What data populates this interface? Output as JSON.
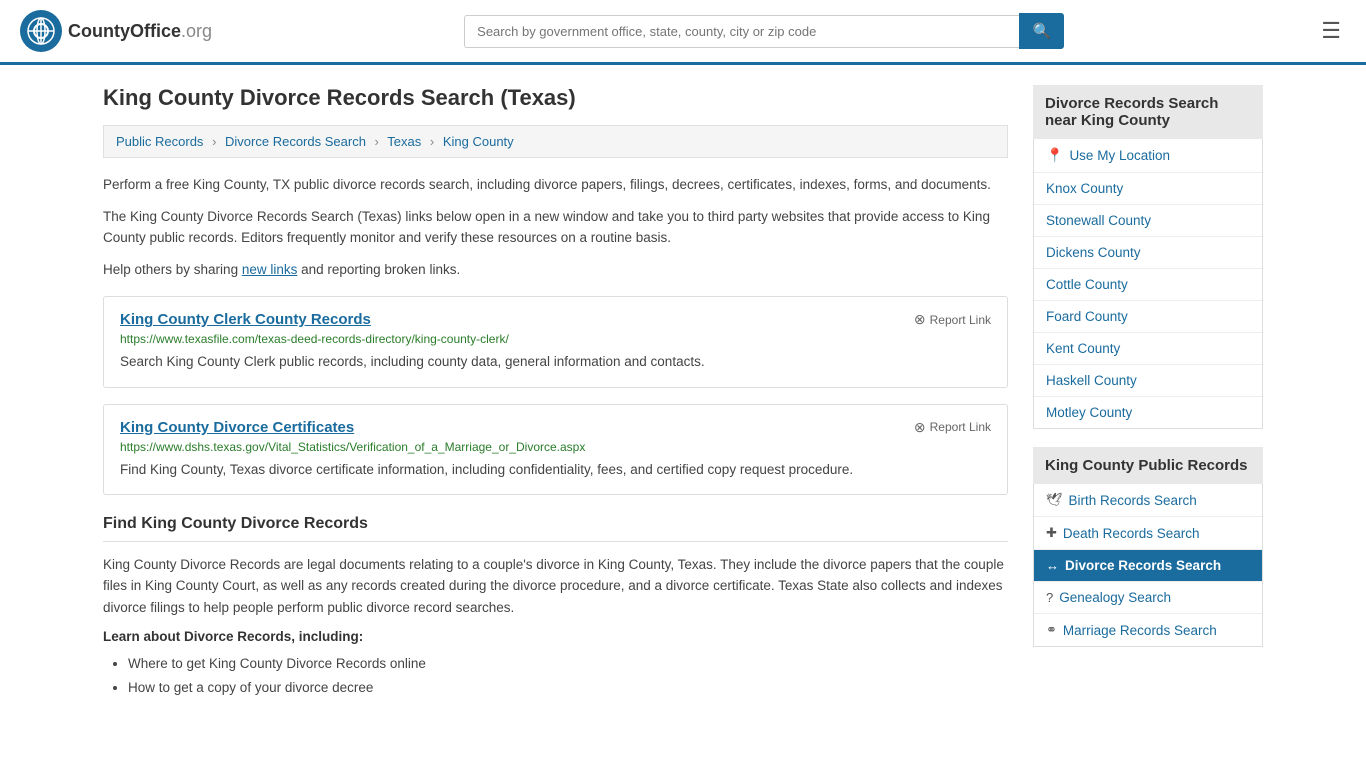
{
  "header": {
    "logo_text": "CountyOffice",
    "logo_org": ".org",
    "search_placeholder": "Search by government office, state, county, city or zip code",
    "search_icon": "🔍",
    "menu_icon": "☰"
  },
  "page": {
    "title": "King County Divorce Records Search (Texas)",
    "breadcrumbs": [
      {
        "label": "Public Records",
        "href": "#"
      },
      {
        "label": "Divorce Records Search",
        "href": "#"
      },
      {
        "label": "Texas",
        "href": "#"
      },
      {
        "label": "King County",
        "href": "#"
      }
    ],
    "intro1": "Perform a free King County, TX public divorce records search, including divorce papers, filings, decrees, certificates, indexes, forms, and documents.",
    "intro2": "The King County Divorce Records Search (Texas) links below open in a new window and take you to third party websites that provide access to King County public records. Editors frequently monitor and verify these resources on a routine basis.",
    "intro3_prefix": "Help others by sharing ",
    "intro3_link": "new links",
    "intro3_suffix": " and reporting broken links.",
    "resources": [
      {
        "title": "King County Clerk County Records",
        "url": "https://www.texasfile.com/texas-deed-records-directory/king-county-clerk/",
        "desc": "Search King County Clerk public records, including county data, general information and contacts.",
        "report_label": "Report Link"
      },
      {
        "title": "King County Divorce Certificates",
        "url": "https://www.dshs.texas.gov/Vital_Statistics/Verification_of_a_Marriage_or_Divorce.aspx",
        "desc": "Find King County, Texas divorce certificate information, including confidentiality, fees, and certified copy request procedure.",
        "report_label": "Report Link"
      }
    ],
    "section_title": "Find King County Divorce Records",
    "body_text": "King County Divorce Records are legal documents relating to a couple's divorce in King County, Texas. They include the divorce papers that the couple files in King County Court, as well as any records created during the divorce procedure, and a divorce certificate. Texas State also collects and indexes divorce filings to help people perform public divorce record searches.",
    "learn_heading": "Learn about Divorce Records, including:",
    "bullets": [
      "Where to get King County Divorce Records online",
      "How to get a copy of your divorce decree"
    ]
  },
  "sidebar": {
    "nearby_title": "Divorce Records Search near King County",
    "use_location": "Use My Location",
    "nearby_counties": [
      {
        "name": "Knox County"
      },
      {
        "name": "Stonewall County"
      },
      {
        "name": "Dickens County"
      },
      {
        "name": "Cottle County"
      },
      {
        "name": "Foard County"
      },
      {
        "name": "Kent County"
      },
      {
        "name": "Haskell County"
      },
      {
        "name": "Motley County"
      }
    ],
    "records_title": "King County Public Records",
    "records_links": [
      {
        "label": "Birth Records Search",
        "icon": "🕊",
        "active": false
      },
      {
        "label": "Death Records Search",
        "icon": "+",
        "active": false
      },
      {
        "label": "Divorce Records Search",
        "icon": "↔",
        "active": true
      },
      {
        "label": "Genealogy Search",
        "icon": "?",
        "active": false
      },
      {
        "label": "Marriage Records Search",
        "icon": "⚭",
        "active": false
      }
    ]
  }
}
